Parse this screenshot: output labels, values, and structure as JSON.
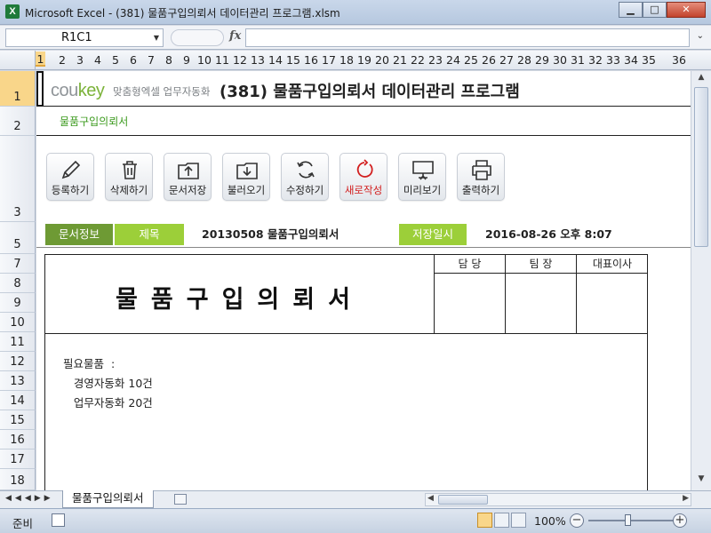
{
  "window": {
    "title": "Microsoft Excel - (381) 물품구입의뢰서 데이터관리 프로그램.xlsm",
    "app_icon": "X",
    "minimize": "▁",
    "maximize": "□",
    "close": "✕"
  },
  "formula_bar": {
    "name_box": "R1C1",
    "fx": "fx",
    "formula": ""
  },
  "columns": [
    "1",
    "2",
    "3",
    "4",
    "5",
    "6",
    "7",
    "8",
    "9",
    "10",
    "11",
    "12",
    "13",
    "14",
    "15",
    "16",
    "17",
    "18",
    "19",
    "20",
    "21",
    "22",
    "23",
    "24",
    "25",
    "26",
    "27",
    "28",
    "29",
    "30",
    "31",
    "32",
    "33",
    "34",
    "35",
    "36"
  ],
  "rows": [
    "1",
    "2",
    "3",
    "5",
    "7",
    "8",
    "9",
    "10",
    "11",
    "12",
    "13",
    "14",
    "15",
    "16",
    "17",
    "18"
  ],
  "sheet": {
    "logo_main": "cou",
    "logo_accent": "key",
    "logo_sub": "맞춤형엑셀 업무자동화",
    "title": "(381) 물품구입의뢰서 데이터관리 프로그램",
    "subtitle": "물품구입의뢰서",
    "toolbar": [
      {
        "label": "등록하기",
        "icon": "pencil-icon"
      },
      {
        "label": "삭제하기",
        "icon": "trash-icon"
      },
      {
        "label": "문서저장",
        "icon": "folder-upload-icon"
      },
      {
        "label": "불러오기",
        "icon": "folder-download-icon"
      },
      {
        "label": "수정하기",
        "icon": "refresh-icon"
      },
      {
        "label": "새로작성",
        "icon": "new-icon"
      },
      {
        "label": "미리보기",
        "icon": "monitor-icon"
      },
      {
        "label": "출력하기",
        "icon": "printer-icon"
      }
    ],
    "info": {
      "doc_info_label": "문서정보",
      "subject_label": "제목",
      "subject_value": "20130508 물품구입의뢰서",
      "saved_label": "저장일시",
      "saved_value": "2016-08-26  오후 8:07"
    },
    "document": {
      "title": "물품구입의뢰서",
      "approvals": [
        "담 당",
        "팀 장",
        "대표이사"
      ],
      "body": "필요물품  :\n   경영자동화 10건\n   업무자동화 20건"
    }
  },
  "tabs": {
    "nav": "◀◀◀▶▶",
    "active": "물품구입의뢰서"
  },
  "status": {
    "mode": "준비",
    "zoom": "100%",
    "zoom_out": "−",
    "zoom_in": "+"
  },
  "colors": {
    "accent_green": "#9ccf39",
    "dark_green": "#6e9a34",
    "subtitle_green": "#3b9a1d",
    "red": "#d21e1e"
  }
}
